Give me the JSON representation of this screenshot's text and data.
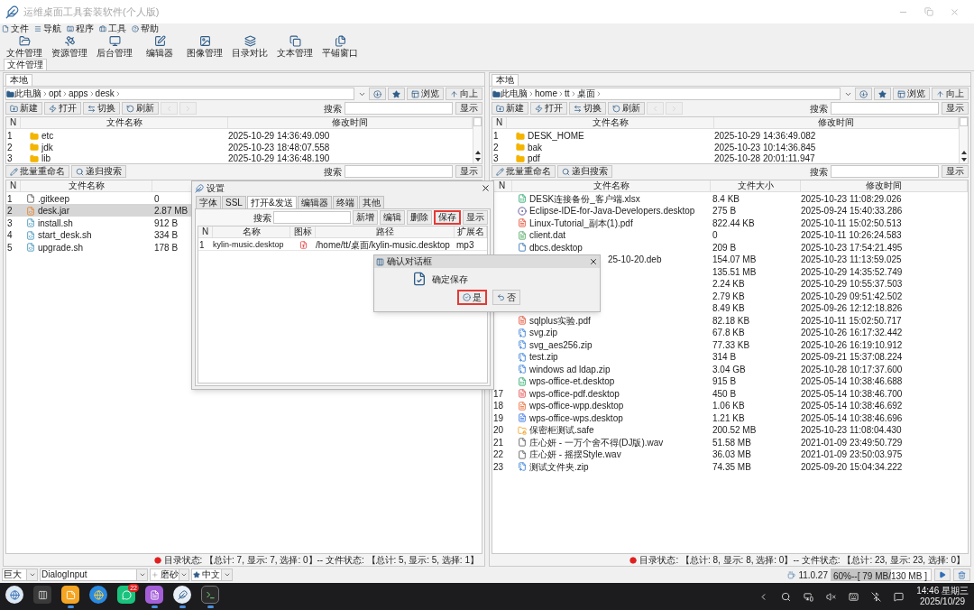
{
  "window": {
    "title": "运维桌面工具套装软件(个人版)"
  },
  "menu": [
    {
      "label": "文件",
      "kind": "file"
    },
    {
      "label": "导航",
      "kind": "list"
    },
    {
      "label": "程序",
      "kind": "keyboard"
    },
    {
      "label": "工具",
      "kind": "toolbox"
    },
    {
      "label": "帮助",
      "kind": "help"
    }
  ],
  "toolbar": [
    {
      "label": "文件管理",
      "kind": "folder"
    },
    {
      "label": "资源管理",
      "kind": "satellite"
    },
    {
      "label": "后台管理",
      "kind": "monitor"
    },
    {
      "label": "编辑器",
      "kind": "edit"
    },
    {
      "label": "图像管理",
      "kind": "image"
    },
    {
      "label": "目录对比",
      "kind": "compare"
    },
    {
      "label": "文本管理",
      "kind": "copy"
    },
    {
      "label": "平铺窗口",
      "kind": "tile"
    }
  ],
  "main_tabs": [
    {
      "label": "文件管理",
      "selected": true
    }
  ],
  "panes": [
    {
      "tabs": [
        {
          "label": "本地",
          "selected": true
        }
      ],
      "path": [
        "此电脑",
        "opt",
        "apps",
        "desk"
      ],
      "browse": "浏览",
      "up": "向上",
      "tools": [
        {
          "label": "新建",
          "kind": "new"
        },
        {
          "label": "打开",
          "kind": "open"
        },
        {
          "label": "切换",
          "kind": "switch"
        },
        {
          "label": "刷新",
          "kind": "refresh"
        }
      ],
      "nav_disabled": true,
      "search_label": "搜索",
      "show": "显示",
      "upper": {
        "columns": [
          "N",
          "文件名称",
          "修改时间"
        ],
        "rows": [
          {
            "n": "1",
            "name": "etc",
            "kind": "folder",
            "modified": "2025-10-29 14:36:49.090"
          },
          {
            "n": "2",
            "name": "jdk",
            "kind": "folder",
            "modified": "2025-10-23 18:48:07.558"
          },
          {
            "n": "3",
            "name": "lib",
            "kind": "folder",
            "modified": "2025-10-29 14:36:48.190"
          }
        ]
      },
      "tools2": [
        {
          "label": "批量重命名",
          "kind": "rename"
        },
        {
          "label": "递归搜索",
          "kind": "search"
        }
      ],
      "search_label2": "搜索",
      "show2": "显示",
      "lower": {
        "columns": [
          "N",
          "文件名称"
        ],
        "rows": [
          {
            "n": "1",
            "name": ".gitkeep",
            "kind": "file",
            "size": "0",
            "selected": false
          },
          {
            "n": "2",
            "name": "desk.jar",
            "kind": "jar",
            "size": "2.87 MB",
            "selected": true
          },
          {
            "n": "3",
            "name": "install.sh",
            "kind": "script",
            "size": "912 B",
            "selected": false
          },
          {
            "n": "4",
            "name": "start_desk.sh",
            "kind": "script",
            "size": "334 B",
            "selected": false
          },
          {
            "n": "5",
            "name": "upgrade.sh",
            "kind": "script",
            "size": "178 B",
            "selected": false
          }
        ]
      },
      "status": "目录状态: 【总计: 7, 显示: 7, 选择: 0】-- 文件状态: 【总计: 5, 显示: 5, 选择: 1】"
    },
    {
      "tabs": [
        {
          "label": "本地",
          "selected": true
        }
      ],
      "path": [
        "此电脑",
        "home",
        "tt",
        "桌面"
      ],
      "browse": "浏览",
      "up": "向上",
      "tools": [
        {
          "label": "新建",
          "kind": "new"
        },
        {
          "label": "打开",
          "kind": "open"
        },
        {
          "label": "切换",
          "kind": "switch"
        },
        {
          "label": "刷新",
          "kind": "refresh"
        }
      ],
      "nav_disabled": true,
      "search_label": "搜索",
      "show": "显示",
      "upper": {
        "columns": [
          "N",
          "文件名称",
          "修改时间"
        ],
        "rows": [
          {
            "n": "1",
            "name": "DESK_HOME",
            "kind": "folder",
            "modified": "2025-10-29 14:36:49.082"
          },
          {
            "n": "2",
            "name": "bak",
            "kind": "folder",
            "modified": "2025-10-23 10:14:36.845"
          },
          {
            "n": "3",
            "name": "pdf",
            "kind": "folder",
            "modified": "2025-10-28 20:01:11.947"
          }
        ]
      },
      "tools2": [
        {
          "label": "批量重命名",
          "kind": "rename"
        },
        {
          "label": "递归搜索",
          "kind": "search"
        }
      ],
      "search_label2": "搜索",
      "show2": "显示",
      "lower": {
        "columns": [
          "N",
          "文件名称",
          "文件大小",
          "修改时间"
        ],
        "rows": [
          {
            "name": "DESK连接备份_客户端.xlsx",
            "kind": "xlsx",
            "size": "8.4 KB",
            "modified": "2025-10-23 11:08:29.026",
            "selected": false
          },
          {
            "name": "Eclipse-IDE-for-Java-Developers.desktop",
            "kind": "desktop",
            "size": "275 B",
            "modified": "2025-09-24 15:40:33.286",
            "selected": false
          },
          {
            "name": "Linux-Tutorial_副本(1).pdf",
            "kind": "pdf",
            "size": "822.44 KB",
            "modified": "2025-10-11 15:02:50.513",
            "selected": false
          },
          {
            "name": "client.dat",
            "kind": "dat",
            "size": "0",
            "modified": "2025-10-11 10:26:24.583",
            "selected": false
          },
          {
            "name": "dbcs.desktop",
            "kind": "shortcut",
            "size": "209 B",
            "modified": "2025-10-23 17:54:21.495",
            "selected": false
          },
          {
            "name": "25-10-20.deb",
            "covered": true,
            "size": "154.07 MB",
            "modified": "2025-10-23 11:13:59.025",
            "selected": false
          },
          {
            "size": "135.51 MB",
            "modified": "2025-10-29 14:35:52.749",
            "selected": false
          },
          {
            "size": "2.24 KB",
            "modified": "2025-10-29 10:55:37.503",
            "selected": false
          },
          {
            "size": "2.79 KB",
            "modified": "2025-10-29 09:51:42.502",
            "selected": false
          },
          {
            "size": "8.49 KB",
            "modified": "2025-09-26 12:12:18.826",
            "selected": false
          },
          {
            "name": "sqlplus实验.pdf",
            "kind": "pdf",
            "size": "82.18 KB",
            "modified": "2025-10-11 15:02:50.717",
            "selected": false
          },
          {
            "name": "svg.zip",
            "kind": "zip",
            "size": "67.8 KB",
            "modified": "2025-10-26 16:17:32.442",
            "selected": false
          },
          {
            "name": "svg_aes256.zip",
            "kind": "zip",
            "size": "77.33 KB",
            "modified": "2025-10-26 16:19:10.912",
            "selected": false
          },
          {
            "name": "test.zip",
            "kind": "zip",
            "size": "314 B",
            "modified": "2025-09-21 15:37:08.224",
            "selected": false
          },
          {
            "name": "windows ad ldap.zip",
            "kind": "zip",
            "size": "3.04 GB",
            "modified": "2025-10-28 10:17:37.600",
            "selected": false
          },
          {
            "name": "wps-office-et.desktop",
            "kind": "et",
            "size": "915 B",
            "modified": "2025-05-14 10:38:46.688",
            "selected": false
          },
          {
            "n": "17",
            "name": "wps-office-pdf.desktop",
            "kind": "wpspdf",
            "size": "450 B",
            "modified": "2025-05-14 10:38:46.700",
            "selected": false
          },
          {
            "n": "18",
            "name": "wps-office-wpp.desktop",
            "kind": "wpp",
            "size": "1.06 KB",
            "modified": "2025-05-14 10:38:46.692",
            "selected": false
          },
          {
            "n": "19",
            "name": "wps-office-wps.desktop",
            "kind": "wps",
            "size": "1.21 KB",
            "modified": "2025-05-14 10:38:46.696",
            "selected": false
          },
          {
            "n": "20",
            "name": "保密柜测试.safe",
            "kind": "safe",
            "size": "200.52 MB",
            "modified": "2025-10-23 11:08:04.430",
            "selected": false
          },
          {
            "n": "21",
            "name": "庄心妍 - 一万个舍不得(DJ版).wav",
            "kind": "audio",
            "size": "51.58 MB",
            "modified": "2021-01-09 23:49:50.729",
            "selected": false
          },
          {
            "n": "22",
            "name": "庄心妍 - 摇摆Style.wav",
            "kind": "audio",
            "size": "36.03 MB",
            "modified": "2021-01-09 23:50:03.975",
            "selected": false
          },
          {
            "n": "23",
            "name": "测试文件夹.zip",
            "kind": "zip",
            "size": "74.35 MB",
            "modified": "2025-09-20 15:04:34.222",
            "selected": false
          }
        ]
      },
      "status": "目录状态: 【总计: 8, 显示: 8, 选择: 0】-- 文件状态: 【总计: 23, 显示: 23, 选择: 0】"
    }
  ],
  "settings_dialog": {
    "title": "设置",
    "tabs": [
      {
        "label": "字体",
        "selected": false
      },
      {
        "label": "SSL",
        "selected": false
      },
      {
        "label": "打开&发送",
        "selected": true
      },
      {
        "label": "编辑器",
        "selected": false
      },
      {
        "label": "终端",
        "selected": false
      },
      {
        "label": "其他",
        "selected": false
      }
    ],
    "search_label": "搜索",
    "buttons": [
      {
        "label": "新增",
        "highlighted": false
      },
      {
        "label": "编辑",
        "highlighted": false
      },
      {
        "label": "删除",
        "highlighted": false
      },
      {
        "label": "保存",
        "highlighted": true
      },
      {
        "label": "显示",
        "highlighted": false
      }
    ],
    "columns": [
      "N",
      "名称",
      "图标",
      "路径",
      "扩展名"
    ],
    "rows": [
      {
        "n": "1",
        "name": "kylin-music.desktop",
        "path": "/home/tt/桌面/kylin-music.desktop",
        "ext": "mp3"
      }
    ]
  },
  "confirm_dialog": {
    "title": "确认对话框",
    "message": "确定保存",
    "buttons": [
      {
        "label": "是",
        "kind": "yes",
        "highlighted": true
      },
      {
        "label": "否",
        "kind": "no",
        "highlighted": false
      }
    ]
  },
  "bottom_bar": {
    "combos": [
      {
        "value": "巨大",
        "kind": "plain"
      },
      {
        "value": "DialogInput",
        "kind": "wide"
      },
      {
        "value": "磨砂",
        "kind": "effect"
      },
      {
        "value": "中文",
        "kind": "language"
      }
    ],
    "java_version": "11.0.27",
    "memory": {
      "reading": "60%--[ 79 MB/130 MB ]",
      "level": 0.6
    }
  },
  "taskbar": {
    "apps": [
      {
        "kind": "launcher",
        "running": false
      },
      {
        "kind": "multitask",
        "running": false
      },
      {
        "kind": "notes",
        "running": true
      },
      {
        "kind": "browser",
        "running": false
      },
      {
        "kind": "chat",
        "running": false,
        "badge": "22"
      },
      {
        "kind": "editor",
        "running": true
      },
      {
        "kind": "feather",
        "running": true
      },
      {
        "kind": "terminal",
        "running": true
      }
    ],
    "time": "14:46 星期三",
    "date": "2025/10/29"
  }
}
